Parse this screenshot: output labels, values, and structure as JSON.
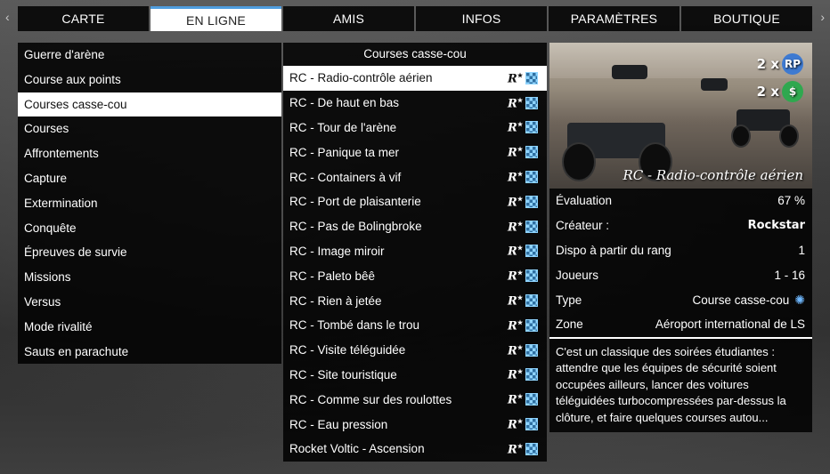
{
  "nav": {
    "tabs": [
      {
        "label": "CARTE"
      },
      {
        "label": "EN LIGNE"
      },
      {
        "label": "AMIS"
      },
      {
        "label": "INFOS"
      },
      {
        "label": "PARAMÈTRES"
      },
      {
        "label": "BOUTIQUE"
      }
    ],
    "prev_arrow": "‹",
    "next_arrow": "›"
  },
  "categories": [
    {
      "label": "Guerre d'arène"
    },
    {
      "label": "Course aux points"
    },
    {
      "label": "Courses casse-cou"
    },
    {
      "label": "Courses"
    },
    {
      "label": "Affrontements"
    },
    {
      "label": "Capture"
    },
    {
      "label": "Extermination"
    },
    {
      "label": "Conquête"
    },
    {
      "label": "Épreuves de survie"
    },
    {
      "label": "Missions"
    },
    {
      "label": "Versus"
    },
    {
      "label": "Mode rivalité"
    },
    {
      "label": "Sauts en parachute"
    }
  ],
  "jobs": {
    "header": "Courses casse-cou",
    "items": [
      {
        "label": "RC - Radio-contrôle aérien"
      },
      {
        "label": "RC - De haut en bas"
      },
      {
        "label": "RC - Tour de l'arène"
      },
      {
        "label": "RC - Panique ta mer"
      },
      {
        "label": "RC - Containers à vif"
      },
      {
        "label": "RC - Port de plaisanterie"
      },
      {
        "label": "RC - Pas de Bolingbroke"
      },
      {
        "label": "RC - Image miroir"
      },
      {
        "label": "RC - Paleto bêê"
      },
      {
        "label": "RC - Rien à jetée"
      },
      {
        "label": "RC - Tombé dans le trou"
      },
      {
        "label": "RC - Visite téléguidée"
      },
      {
        "label": "RC - Site touristique"
      },
      {
        "label": "RC - Comme sur des roulottes"
      },
      {
        "label": "RC - Eau pression"
      },
      {
        "label": "Rocket Voltic - Ascension"
      }
    ]
  },
  "details": {
    "preview_title": "RC - Radio-contrôle aérien",
    "rp_multiplier": "2 x",
    "rp_label": "RP",
    "cash_multiplier": "2 x",
    "cash_symbol": "$",
    "rows": {
      "rating_label": "Évaluation",
      "rating_value": "67 %",
      "creator_label": "Créateur :",
      "creator_value": "Rockstar",
      "rank_label": "Dispo à partir du rang",
      "rank_value": "1",
      "players_label": "Joueurs",
      "players_value": "1 - 16",
      "type_label": "Type",
      "type_value": "Course casse-cou",
      "zone_label": "Zone",
      "zone_value": "Aéroport international de LS"
    },
    "description": "C'est un classique des soirées étudiantes : attendre que les équipes de sécurité soient occupées ailleurs, lancer des voitures téléguidées turbocompressées par-dessus la clôture, et faire quelques courses autou..."
  },
  "colors": {
    "accent": "#4f9dde",
    "panel": "#000000",
    "rp": "#3e7ad1",
    "cash": "#2fa84f"
  }
}
